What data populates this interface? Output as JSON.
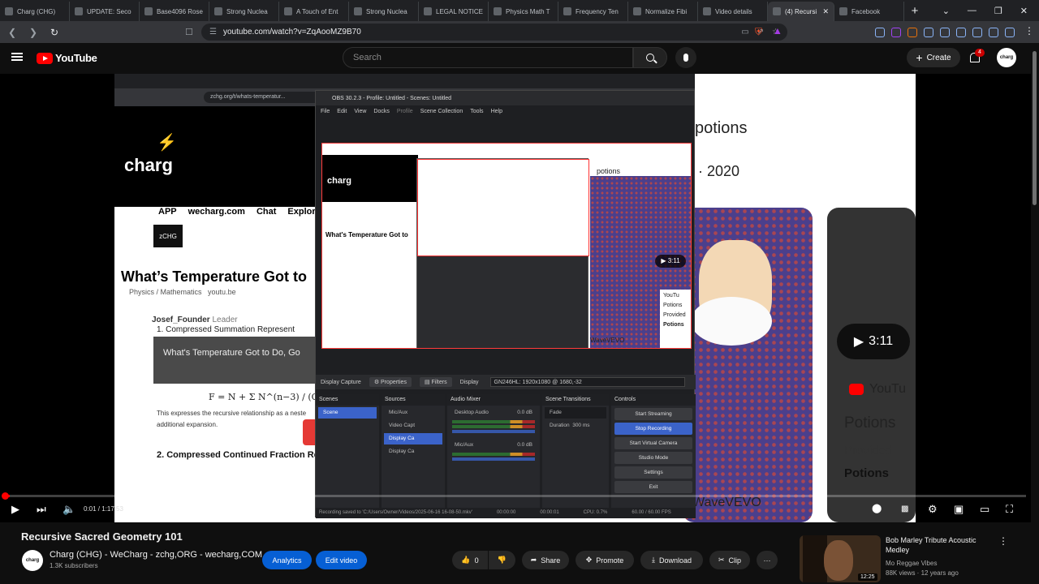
{
  "browser": {
    "tabs": [
      {
        "label": "Charg (CHG)",
        "active": false
      },
      {
        "label": "UPDATE: Seco",
        "active": false
      },
      {
        "label": "Base4096 Rose",
        "active": false
      },
      {
        "label": "Strong Nuclea",
        "active": false
      },
      {
        "label": "A Touch of Ent",
        "active": false
      },
      {
        "label": "Strong Nuclea",
        "active": false
      },
      {
        "label": "LEGAL NOTICE",
        "active": false
      },
      {
        "label": "Physics Math T",
        "active": false
      },
      {
        "label": "Frequency Ten",
        "active": false
      },
      {
        "label": "Normalize Fibi",
        "active": false
      },
      {
        "label": "Video details",
        "active": false
      },
      {
        "label": "(4) Recursi",
        "active": true
      },
      {
        "label": "Facebook",
        "active": false
      }
    ],
    "new_tab": "+",
    "window_controls": [
      "⌄",
      "—",
      "❐",
      "✕"
    ],
    "url": "youtube.com/watch?v=ZqAooMZ9B70"
  },
  "youtube": {
    "logo_text": "YouTube",
    "search_placeholder": "Search",
    "create_label": "Create",
    "notification_count": "4",
    "avatar_text": "charg"
  },
  "video_content": {
    "inner_url": "zchg.org/t/whats-temperatur...",
    "brand": "charg",
    "nav": [
      "APP",
      "wecharg.com",
      "Chat",
      "Explore"
    ],
    "zchg_badge": "zCHG",
    "article_title": "What’s Temperature Got to",
    "category": "Physics / Mathematics",
    "link": "youtu.be",
    "author": "Josef_Founder",
    "author_role": "Leader",
    "thumb_heading": "1. Compressed Summation Represent",
    "thumb_title": "What's Temperature Got to Do, Go",
    "formula": "F = N + Σ N^(n−3) / (C²)^k",
    "body_text": "This expresses the recursive relationship as a neste additional expansion.",
    "section2": "2. Compressed Continued Fraction Re",
    "right_potions": "potions",
    "right_year": "e · 2020",
    "right_duration": "3:11",
    "right_youtube": "YouTu",
    "right_potions_title": "Potions",
    "right_provided": "Provided",
    "right_potions_bold": "Potions",
    "right_vevo": "WaveVEVO"
  },
  "obs": {
    "title": "OBS 30.2.3 - Profile: Untitled - Scenes: Untitled",
    "menu": [
      "File",
      "Edit",
      "View",
      "Docks",
      "Profile",
      "Scene Collection",
      "Tools",
      "Help"
    ],
    "source_label": "Display Capture",
    "properties": "Properties",
    "filters": "Filters",
    "display_label": "Display",
    "display_value": "GN246HL: 1920x1080 @ 1680,-32",
    "scenes_header": "Scenes",
    "scenes": [
      "Scene"
    ],
    "sources_header": "Sources",
    "sources": [
      "Mic/Aux",
      "Video Capt",
      "Display Ca",
      "Display Ca"
    ],
    "mixer_header": "Audio Mixer",
    "mixer_channels": [
      {
        "name": "Desktop Audio",
        "level": "0.0 dB"
      },
      {
        "name": "Mic/Aux",
        "level": "0.0 dB"
      }
    ],
    "transitions_header": "Scene Transitions",
    "transition": "Fade",
    "duration_label": "Duration",
    "duration_value": "300 ms",
    "controls_header": "Controls",
    "controls": [
      "Start Streaming",
      "Stop Recording",
      "Start Virtual Camera",
      "Studio Mode",
      "Settings",
      "Exit"
    ],
    "status_saved": "Recording saved to 'C:/Users/Owner/Videos/2025-06-16 16-08-50.mkv'",
    "status_stream": "00:00:00",
    "status_rec": "00:00:01",
    "status_cpu": "CPU: 0.7%",
    "status_fps": "60.00 / 60.00 FPS",
    "preview": {
      "potions": "potions",
      "year": "· 2020",
      "duration": "▶ 3:11",
      "title": "What's Temperature Got to",
      "vevo": "WaveVEVO",
      "side": [
        "YouTu",
        "Potions",
        "Provided",
        "Potions"
      ],
      "brand": "charg"
    }
  },
  "player": {
    "time": "0:01 / 1:17:53",
    "progress_fraction": 0.005
  },
  "below": {
    "title": "Recursive Sacred Geometry 101",
    "channel_name": "Charg (CHG) - WeCharg - zchg,ORG - wecharg,COM",
    "subscribers": "1.3K subscribers",
    "channel_avatar": "charg",
    "analytics": "Analytics",
    "edit_video": "Edit video",
    "like_count": "0",
    "share": "Share",
    "promote": "Promote",
    "download": "Download",
    "clip": "Clip",
    "more": "···"
  },
  "recommended": {
    "title": "Bob Marley Tribute Acoustic Medley",
    "channel": "Mo Reggae Vibes",
    "meta": "88K views · 12 years ago",
    "duration": "12:25"
  }
}
